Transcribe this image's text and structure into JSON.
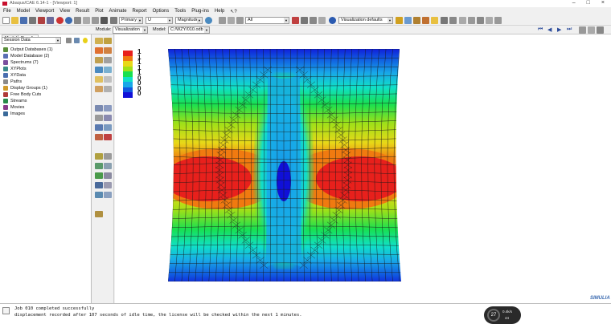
{
  "window": {
    "title": "Abaqus/CAE 6.14-1 - [Viewport: 1]"
  },
  "menu": [
    "File",
    "Model",
    "Viewport",
    "View",
    "Result",
    "Plot",
    "Animate",
    "Report",
    "Options",
    "Tools",
    "Plug-ins",
    "Help"
  ],
  "toolbar": {
    "display_group": "Primary",
    "field_output": "U",
    "invariant": "Magnitude",
    "selection_filter": "All",
    "render_style": "Visualization defaults"
  },
  "context": {
    "module_label": "Module:",
    "module_value": "Visualization",
    "model_label": "Model:",
    "model_value": "C:/WZY/010.odb"
  },
  "tree": {
    "tabs": [
      "Model",
      "Results"
    ],
    "session_data": "Session Data",
    "items": [
      {
        "label": "Output Databases (1)",
        "color": "#5a8f3a"
      },
      {
        "label": "Model Database (2)",
        "color": "#5b6fb3"
      },
      {
        "label": "Spectrums (7)",
        "color": "#7a4f9e"
      },
      {
        "label": "XYPlots",
        "color": "#3a8a8a"
      },
      {
        "label": "XYData",
        "color": "#4a6fb0"
      },
      {
        "label": "Paths",
        "color": "#8a8a8a"
      },
      {
        "label": "Display Groups (1)",
        "color": "#d09a2a"
      },
      {
        "label": "Free Body Cuts",
        "color": "#b03a3a"
      },
      {
        "label": "Streams",
        "color": "#2a8a4a"
      },
      {
        "label": "Movies",
        "color": "#8a3a8a"
      },
      {
        "label": "Images",
        "color": "#3a6a9a"
      }
    ]
  },
  "legend": {
    "labels": [
      "1",
      "1",
      "1",
      "1",
      "1",
      "0",
      "0",
      "0",
      "0"
    ],
    "colors": [
      "#e8201c",
      "#f07a10",
      "#e8d818",
      "#a0e018",
      "#18e050",
      "#10e0c8",
      "#18a8e8",
      "#1058e0",
      "#1010d8"
    ]
  },
  "console": {
    "lines": [
      "Job 010 completed successfully",
      "   displacement recorded after 107 seconds of idle time, the license will be checked within the next 1 minutes."
    ]
  },
  "status": {
    "gauge": "27",
    "speed_top": "0.4k/s",
    "speed_bottom": "44"
  },
  "brand": "SIMULIA"
}
